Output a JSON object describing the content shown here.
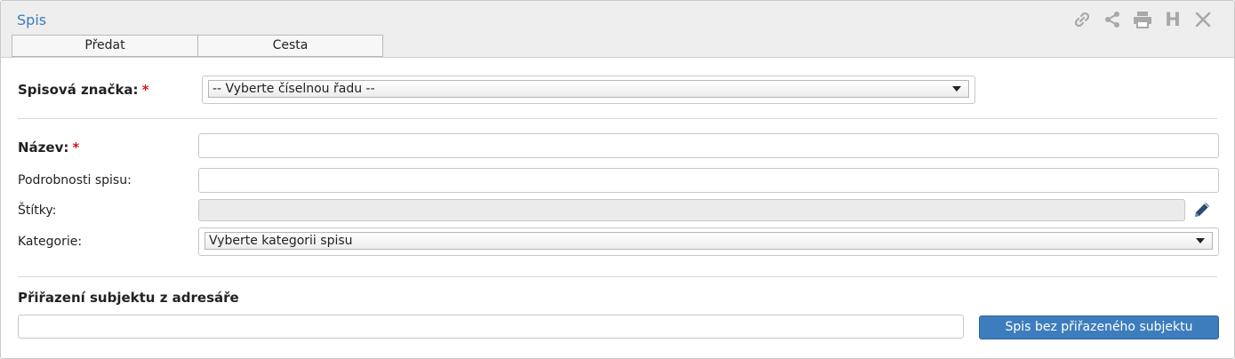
{
  "window": {
    "title": "Spis",
    "icons": [
      "link-icon",
      "share-icon",
      "print-icon",
      "h-icon",
      "close-icon"
    ],
    "h_icon_text": "H"
  },
  "tabs": [
    {
      "label": "Předat"
    },
    {
      "label": "Cesta"
    }
  ],
  "form": {
    "spisova_znacka": {
      "label": "Spisová značka:",
      "required_mark": "*",
      "selected": "-- Vyberte číselnou řadu --"
    },
    "nazev": {
      "label": "Název:",
      "required_mark": "*",
      "value": ""
    },
    "podrobnosti": {
      "label": "Podrobnosti spisu:",
      "value": ""
    },
    "stitky": {
      "label": "Štítky:",
      "value": ""
    },
    "kategorie": {
      "label": "Kategorie:",
      "selected": "Vyberte kategorii spisu"
    }
  },
  "assignment": {
    "heading": "Přiřazení subjektu z adresáře",
    "search_value": "",
    "button_label": "Spis bez přiřazeného subjektu"
  },
  "colors": {
    "title": "#3b7bbf",
    "accent_button": "#3d7dbd",
    "required": "#d11a1a",
    "icon_gray": "#a8a8a8"
  }
}
